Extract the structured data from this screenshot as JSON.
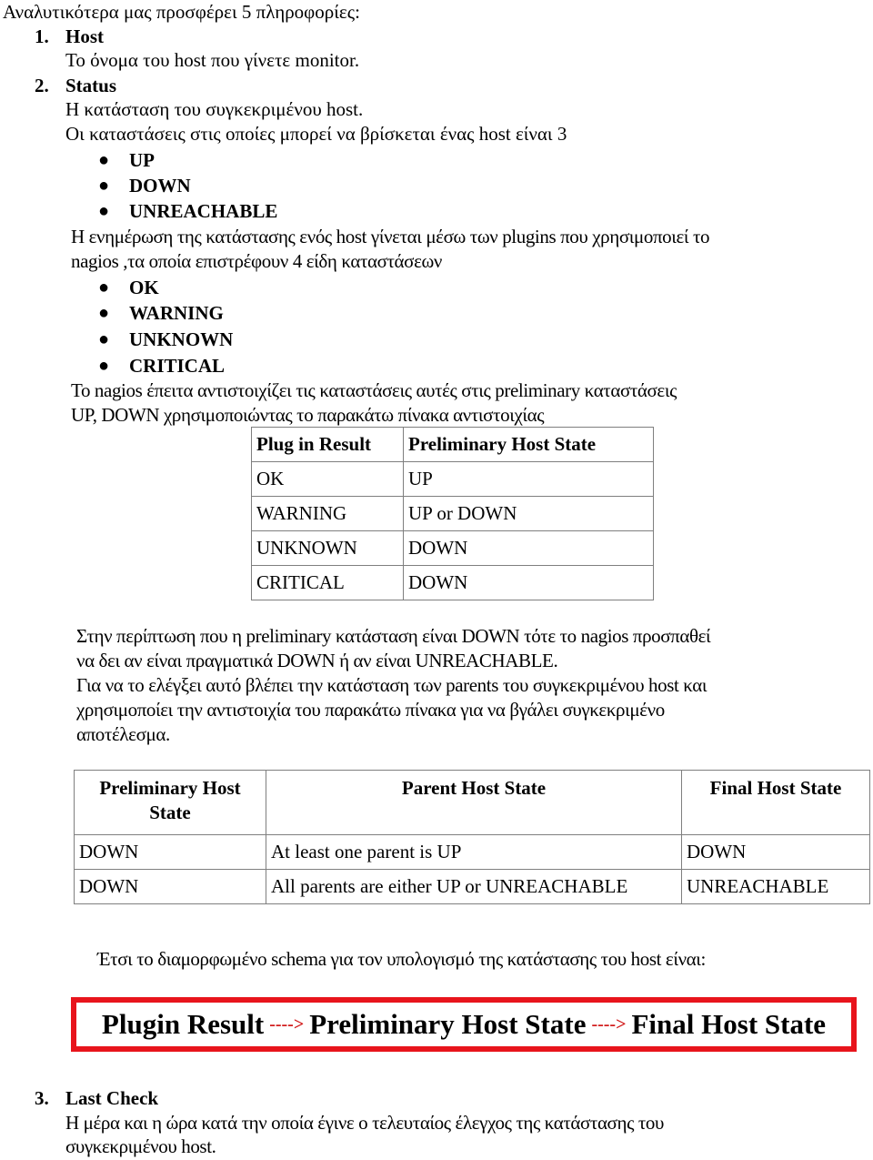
{
  "intro": "Αναλυτικότερα μας προσφέρει 5 πληροφορίες:",
  "items": [
    {
      "number": "1.",
      "title": "Host",
      "description": "Το όνομα του host που γίνετε monitor."
    },
    {
      "number": "2.",
      "title": "Status",
      "description": "Η κατάσταση του συγκεκριμένου host.",
      "states_intro": "Οι καταστάσεις στις οποίες μπορεί να βρίσκεται ένας host είναι 3",
      "host_states": [
        "UP",
        "DOWN",
        "UNREACHABLE"
      ],
      "plugins_text_1": "Η ενημέρωση της κατάστασης ενός host γίνεται μέσω των plugins που χρησιμοποιεί το",
      "plugins_text_2": "nagios ,τα οποία επιστρέφουν 4 είδη καταστάσεων",
      "plugin_states": [
        "OK",
        "WARNING",
        "UNKNOWN",
        "CRITICAL"
      ],
      "mapping_text_1": "Το nagios έπειτα αντιστοιχίζει τις καταστάσεις αυτές στις preliminary καταστάσεις",
      "mapping_text_2": "UP, DOWN χρησιμοποιώντας το παρακάτω πίνακα αντιστοιχίας",
      "table1": {
        "headers": [
          "Plug in Result",
          "Preliminary Host State"
        ],
        "rows": [
          [
            "OK",
            "UP"
          ],
          [
            "WARNING",
            "UP or DOWN"
          ],
          [
            "UNKNOWN",
            "DOWN"
          ],
          [
            "CRITICAL",
            "DOWN"
          ]
        ]
      },
      "down_text_1": "Στην περίπτωση που η preliminary κατάσταση είναι DOWN τότε το nagios προσπαθεί",
      "down_text_2": "να δει αν είναι πραγματικά DOWN ή αν είναι UNREACHABLE.",
      "parents_text_1": "Για να το ελέγξει αυτό βλέπει την κατάσταση των parents του συγκεκριμένου host και",
      "parents_text_2": "χρησιμοποίει την αντιστοιχία του παρακάτω πίνακα για να βγάλει συγκεκριμένο",
      "parents_text_3": "αποτέλεσμα.",
      "table2": {
        "headers": [
          "Preliminary Host State",
          "Parent Host State",
          "Final Host State"
        ],
        "rows": [
          [
            "DOWN",
            "At least one parent is UP",
            "DOWN"
          ],
          [
            "DOWN",
            "All parents are either UP or UNREACHABLE",
            "UNREACHABLE"
          ]
        ]
      },
      "schema_text": "Έτσι το διαμορφωμένο schema για τον υπολογισμό της κατάστασης του host είναι:",
      "schema": {
        "step1": "Plugin Result",
        "arrow": "---->",
        "step2": "Preliminary Host State",
        "step3": "Final Host State",
        "border_color": "#e8141c",
        "arrow_color": "#d11a1a"
      }
    },
    {
      "number": "3.",
      "title": "Last Check",
      "description_1": "Η μέρα και η ώρα κατά την οποία έγινε ο τελευταίος έλεγχος της κατάστασης του",
      "description_2": "συγκεκριμένου host."
    }
  ]
}
